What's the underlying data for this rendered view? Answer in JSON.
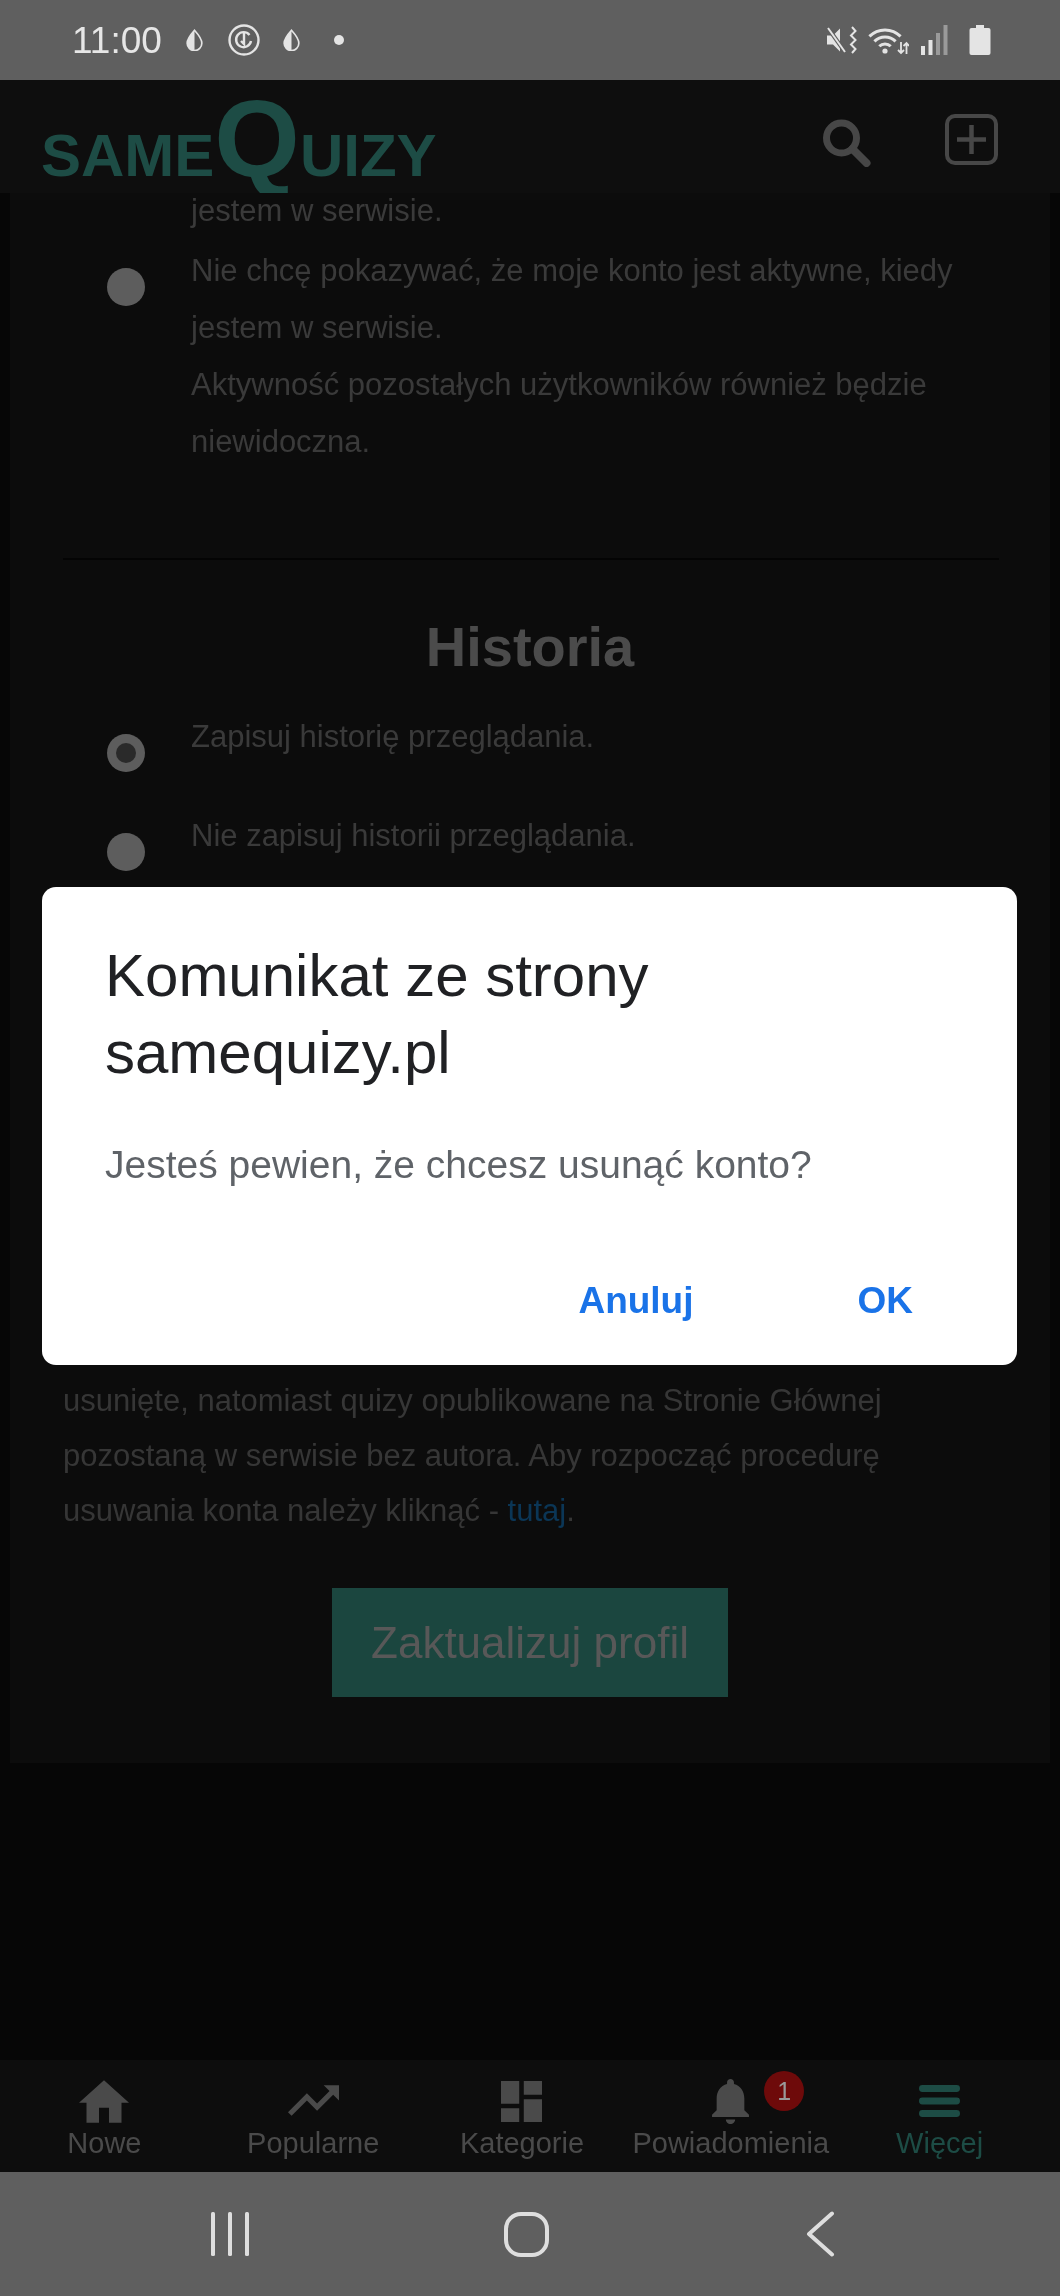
{
  "status_bar": {
    "time": "11:00"
  },
  "header": {
    "logo": {
      "before": "SAME",
      "initial": "Q",
      "after": "UIZY"
    }
  },
  "page": {
    "clipped_option_text": "jestem w serwisie.",
    "activity_option": {
      "selected": false,
      "lines": [
        "Nie chcę pokazywać, że moje konto jest aktywne, kiedy jestem w serwisie.",
        "Aktywność pozostałych użytkowników również będzie niewidoczna."
      ]
    },
    "history": {
      "title": "Historia",
      "options": [
        {
          "label": "Zapisuj historię przeglądania.",
          "selected": true
        },
        {
          "label": "Nie zapisuj historii przeglądania.",
          "selected": false
        }
      ]
    },
    "delete_note": {
      "text": "usunięte, natomiast quizy opublikowane na Stronie Głównej pozostaną w serwisie bez autora. Aby rozpocząć procedurę usuwania konta należy kliknąć - ",
      "link": "tutaj",
      "after": "."
    },
    "update_button": "Zaktualizuj profil"
  },
  "dialog": {
    "title": "Komunikat ze strony samequizy.pl",
    "message": "Jesteś pewien, że chcesz usunąć konto?",
    "buttons": [
      "Anuluj",
      "OK"
    ]
  },
  "bottom_nav": [
    {
      "label": "Nowe",
      "selected": false
    },
    {
      "label": "Popularne",
      "selected": false
    },
    {
      "label": "Kategorie",
      "selected": false
    },
    {
      "label": "Powiadomienia",
      "selected": false,
      "badge": "1"
    },
    {
      "label": "Więcej",
      "selected": true
    }
  ]
}
